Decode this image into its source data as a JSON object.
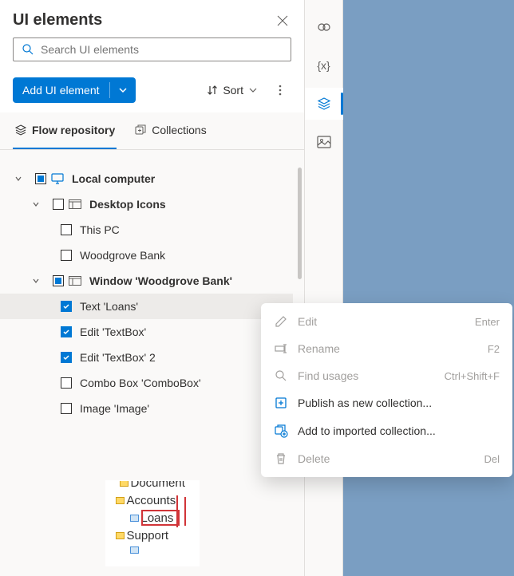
{
  "header": {
    "title": "UI elements"
  },
  "search": {
    "placeholder": "Search UI elements"
  },
  "toolbar": {
    "add_label": "Add UI element",
    "sort_label": "Sort"
  },
  "tabs": {
    "flow_repo": "Flow repository",
    "collections": "Collections"
  },
  "tree": {
    "local_computer": "Local computer",
    "desktop_icons": "Desktop Icons",
    "this_pc": "This PC",
    "woodgrove_bank": "Woodgrove Bank",
    "window_woodgrove": "Window 'Woodgrove Bank'",
    "text_loans": "Text 'Loans'",
    "edit_textbox": "Edit 'TextBox'",
    "edit_textbox2": "Edit 'TextBox' 2",
    "combo_box": "Combo Box 'ComboBox'",
    "image_image": "Image 'Image'"
  },
  "preview": {
    "document": "Document",
    "accounts": "Accounts",
    "loans": "Loans",
    "support": "Support"
  },
  "context_menu": {
    "edit": {
      "label": "Edit",
      "shortcut": "Enter"
    },
    "rename": {
      "label": "Rename",
      "shortcut": "F2"
    },
    "find_usages": {
      "label": "Find usages",
      "shortcut": "Ctrl+Shift+F"
    },
    "publish": {
      "label": "Publish as new collection..."
    },
    "add_imported": {
      "label": "Add to imported collection..."
    },
    "delete": {
      "label": "Delete",
      "shortcut": "Del"
    }
  }
}
